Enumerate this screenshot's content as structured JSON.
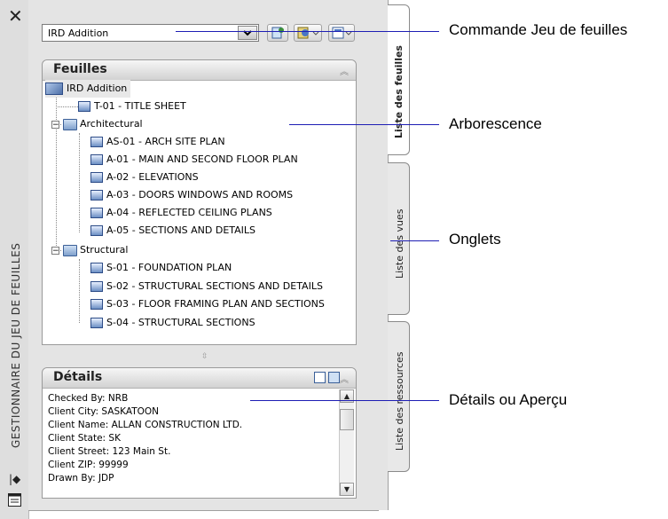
{
  "palette": {
    "vertical_title": "GESTIONNAIRE DU JEU DE FEUILLES",
    "close_icon": "close-icon",
    "autohide_icon": "autohide-icon",
    "properties_icon": "properties-icon"
  },
  "toolbar": {
    "sheet_set_combo_value": "IRD Addition"
  },
  "sheets_panel": {
    "title": "Feuilles",
    "root": "IRD Addition",
    "items": [
      {
        "label": "T-01 - TITLE SHEET",
        "type": "sheet",
        "level": 1
      },
      {
        "label": "Architectural",
        "type": "subset",
        "level": 1
      },
      {
        "label": "AS-01 - ARCH SITE PLAN",
        "type": "sheet",
        "level": 2
      },
      {
        "label": "A-01 - MAIN AND SECOND FLOOR PLAN",
        "type": "sheet",
        "level": 2
      },
      {
        "label": "A-02 - ELEVATIONS",
        "type": "sheet",
        "level": 2
      },
      {
        "label": "A-03 - DOORS WINDOWS AND ROOMS",
        "type": "sheet",
        "level": 2
      },
      {
        "label": "A-04 - REFLECTED CEILING PLANS",
        "type": "sheet",
        "level": 2
      },
      {
        "label": "A-05 - SECTIONS AND DETAILS",
        "type": "sheet",
        "level": 2
      },
      {
        "label": "Structural",
        "type": "subset",
        "level": 1
      },
      {
        "label": "S-01 - FOUNDATION PLAN",
        "type": "sheet",
        "level": 2
      },
      {
        "label": "S-02 - STRUCTURAL SECTIONS AND DETAILS",
        "type": "sheet",
        "level": 2
      },
      {
        "label": "S-03 - FLOOR FRAMING PLAN AND SECTIONS",
        "type": "sheet",
        "level": 2
      },
      {
        "label": "S-04 - STRUCTURAL SECTIONS",
        "type": "sheet",
        "level": 2
      }
    ]
  },
  "details_panel": {
    "title": "Détails",
    "lines": [
      "Checked By: NRB",
      "Client City: SASKATOON",
      "Client Name: ALLAN CONSTRUCTION LTD.",
      "Client State: SK",
      "Client Street: 123 Main St.",
      "Client ZIP: 99999",
      "Drawn By: JDP"
    ]
  },
  "tabs": [
    "Liste des feuilles",
    "Liste des vues",
    "Liste des ressources"
  ],
  "callouts": {
    "combo": "Commande Jeu de feuilles",
    "tree": "Arborescence",
    "tabs": "Onglets",
    "details": "Détails ou Aperçu"
  },
  "colors": {
    "callout_line": "#1e1eb4",
    "panel_bg": "#e4e4e4"
  }
}
